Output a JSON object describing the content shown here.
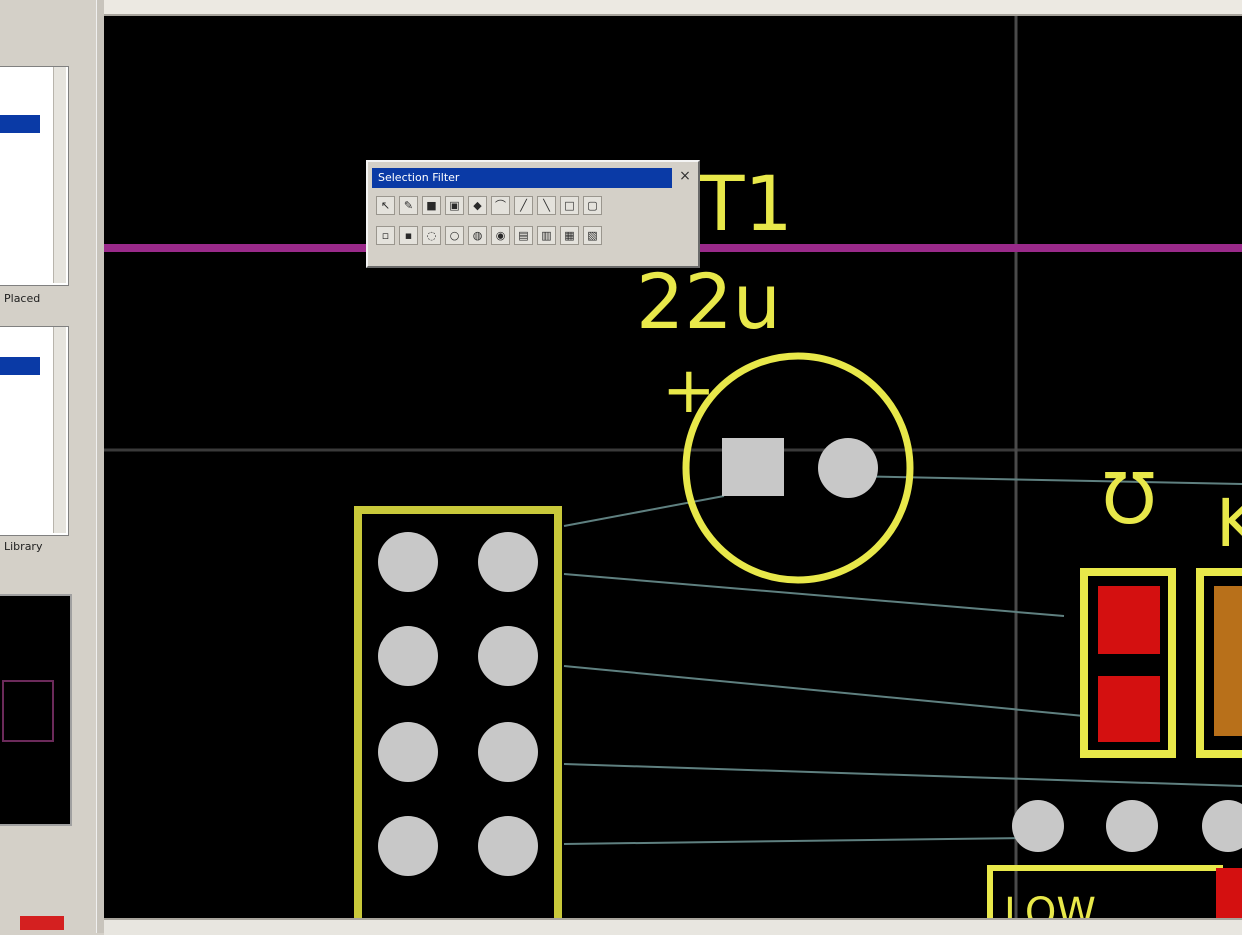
{
  "left_panel": {
    "captions": [
      "Placed",
      "Library"
    ]
  },
  "floating_toolbar": {
    "title": "Selection Filter",
    "close_glyph": "×",
    "row1": [
      "↖",
      "✎",
      "■",
      "▣",
      "◆",
      "⌒",
      "╱",
      "╲",
      "□",
      "▢"
    ],
    "row2": [
      "▫",
      "▪",
      "◌",
      "○",
      "◍",
      "◉",
      "▤",
      "▥",
      "▦",
      "▧"
    ]
  },
  "pcb": {
    "designators": {
      "capacitor_ref": "T1",
      "capacitor_value": "22u",
      "polarity_mark": "+",
      "resistor_ohm": "Ω",
      "resistor_partial": "K",
      "bottom_label": "LOW"
    },
    "colors": {
      "background": "#000000",
      "silkscreen": "#e8e84a",
      "top_copper": "#d41010",
      "pad": "#c8c8c8",
      "track_highlight": "#9a2a8a",
      "ratsnest": "#6a8a8a"
    }
  }
}
